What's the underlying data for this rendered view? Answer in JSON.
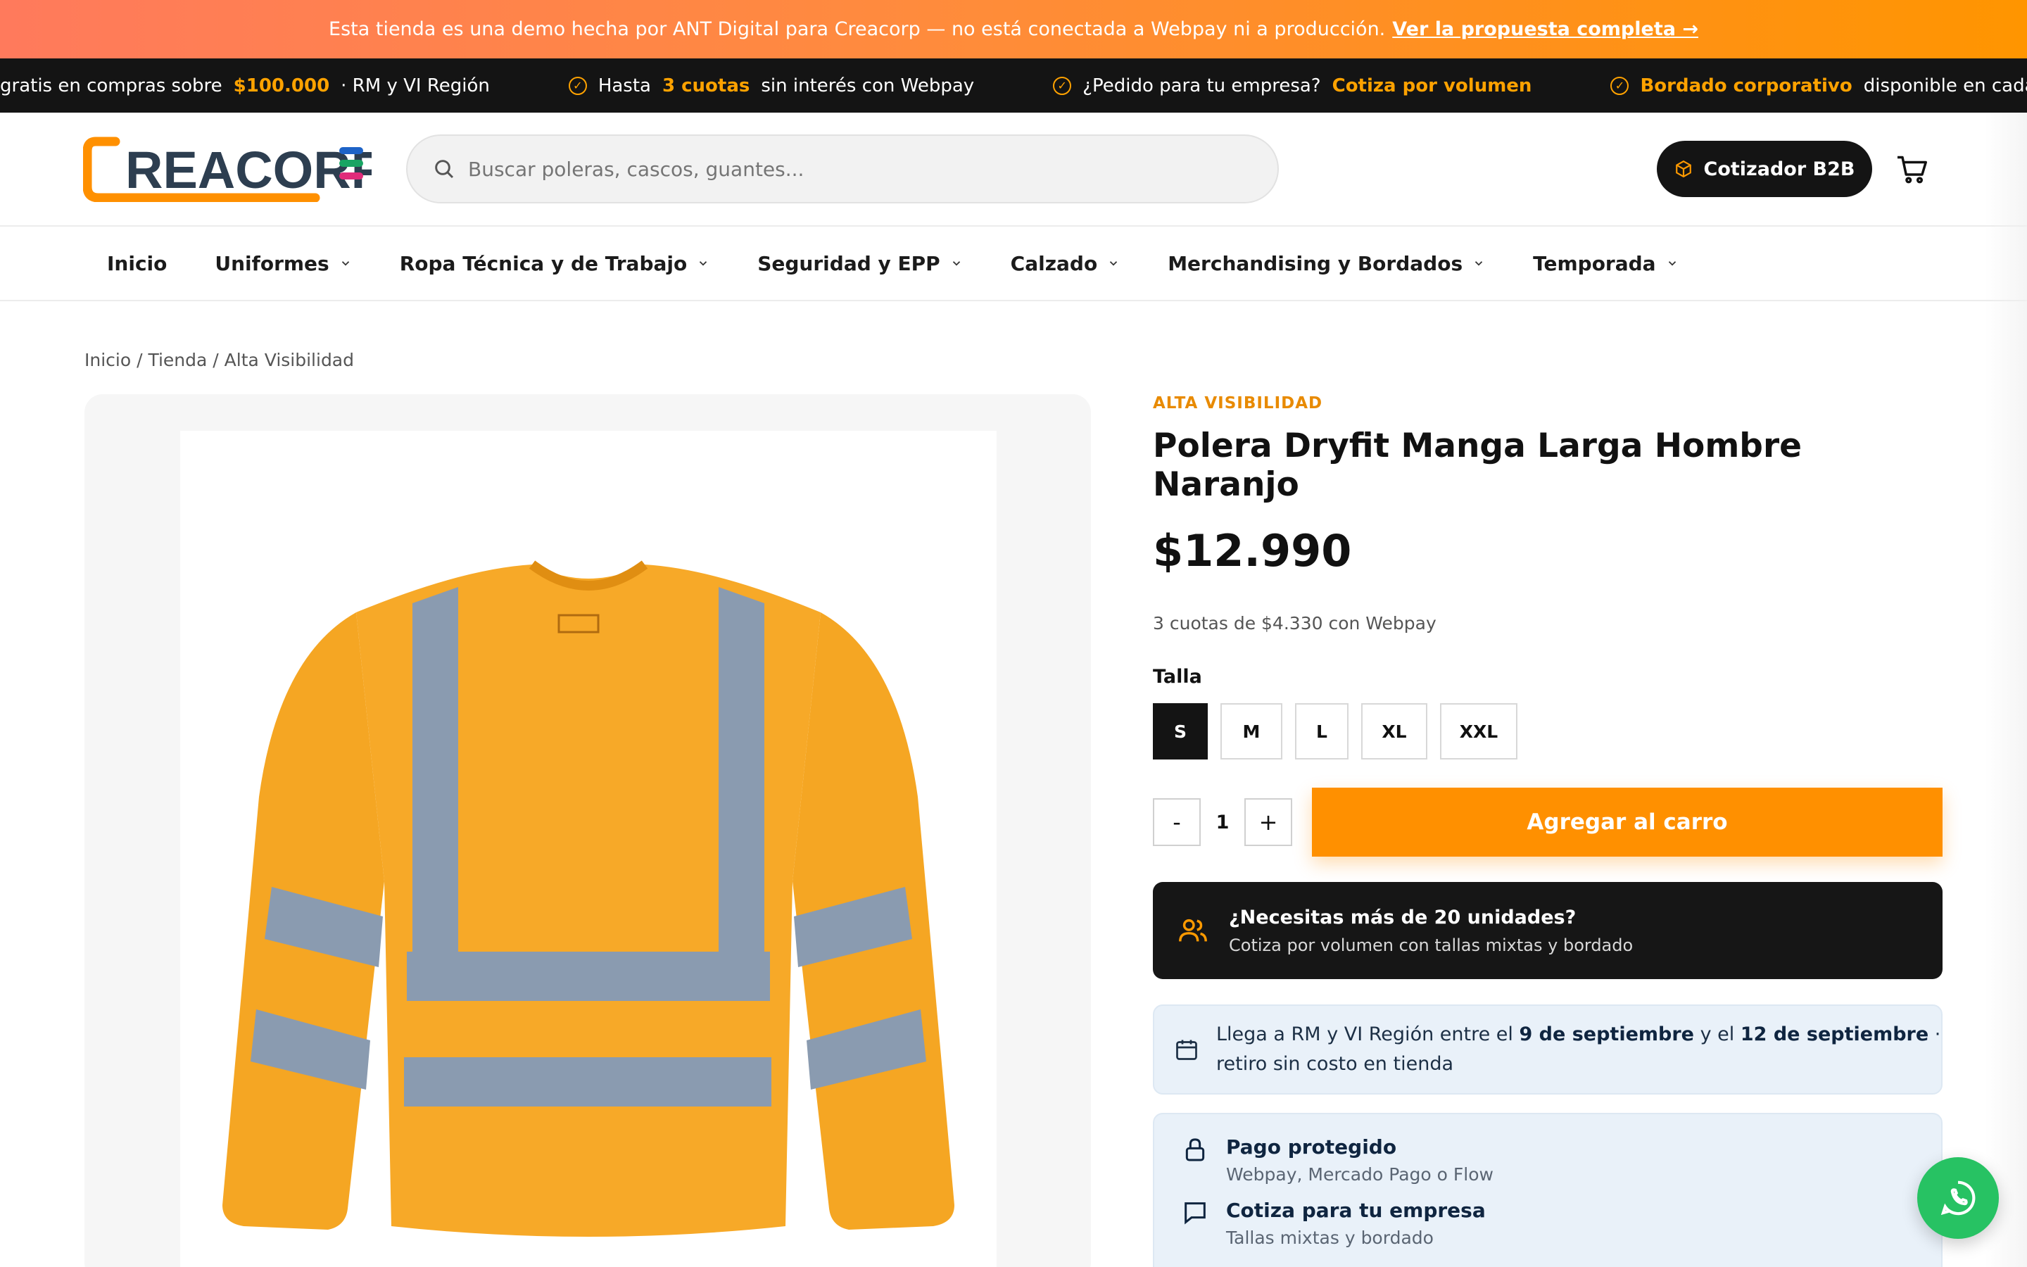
{
  "demo_banner": {
    "text": "Esta tienda es una demo hecha por ANT Digital para Creacorp — no está conectada a Webpay ni a producción.",
    "link": "Ver la propuesta completa →"
  },
  "ticker": [
    {
      "pre": "gratis en compras sobre",
      "hl": "$100.000",
      "post": "· RM y VI Región"
    },
    {
      "pre": "Hasta",
      "hl": "3 cuotas",
      "post": "sin interés con Webpay"
    },
    {
      "pre": "¿Pedido para tu empresa?",
      "hl": "Cotiza por volumen",
      "post": ""
    },
    {
      "pre": "",
      "hl": "Bordado corporativo",
      "post": "disponible en cada"
    }
  ],
  "header": {
    "logo_text": "REACORP",
    "search_placeholder": "Buscar poleras, cascos, guantes...",
    "b2b_label": "Cotizador B2B"
  },
  "nav": [
    {
      "label": "Inicio",
      "dropdown": false
    },
    {
      "label": "Uniformes",
      "dropdown": true
    },
    {
      "label": "Ropa Técnica y de Trabajo",
      "dropdown": true
    },
    {
      "label": "Seguridad y EPP",
      "dropdown": true
    },
    {
      "label": "Calzado",
      "dropdown": true
    },
    {
      "label": "Merchandising y Bordados",
      "dropdown": true
    },
    {
      "label": "Temporada",
      "dropdown": true
    }
  ],
  "breadcrumb": "Inicio / Tienda / Alta Visibilidad",
  "product": {
    "category": "ALTA VISIBILIDAD",
    "title": "Polera Dryfit Manga Larga Hombre Naranjo",
    "price": "$12.990",
    "installments": "3 cuotas de $4.330 con Webpay",
    "size_label": "Talla",
    "sizes": [
      "S",
      "M",
      "L",
      "XL",
      "XXL"
    ],
    "selected_size": "S",
    "qty_minus": "-",
    "qty_value": "1",
    "qty_plus": "+",
    "add_to_cart": "Agregar al carro"
  },
  "volume_box": {
    "title": "¿Necesitas más de 20 unidades?",
    "subtitle": "Cotiza por volumen con tallas mixtas y bordado"
  },
  "shipping": {
    "pre": "Llega a RM y VI Región entre el",
    "date1": "9 de septiembre",
    "mid": "y el",
    "date2": "12 de septiembre",
    "post": "·",
    "line2": "retiro sin costo en tienda"
  },
  "trust": [
    {
      "title": "Pago protegido",
      "subtitle": "Webpay, Mercado Pago o Flow"
    },
    {
      "title": "Cotiza para tu empresa",
      "subtitle": "Tallas mixtas y bordado"
    }
  ],
  "colors": {
    "accent": "#ff9000",
    "dark": "#141414",
    "highlight": "#ffa200",
    "whatsapp": "#27c263"
  }
}
